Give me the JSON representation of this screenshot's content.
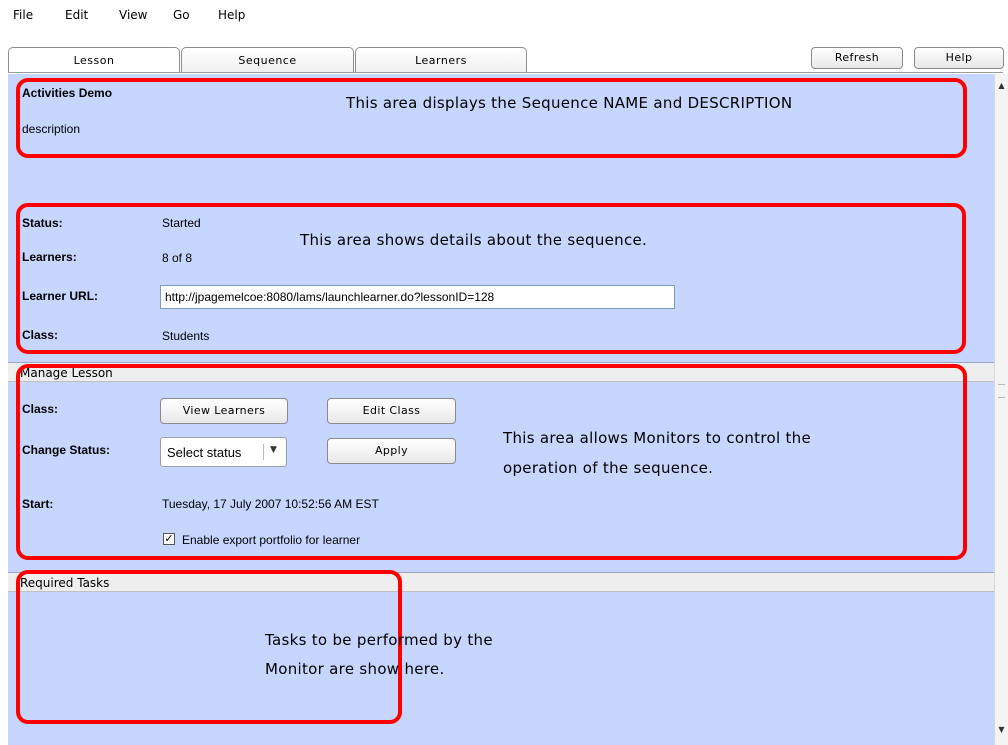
{
  "menu": [
    "File",
    "Edit",
    "View",
    "Go",
    "Help"
  ],
  "tabs": [
    {
      "label": "Lesson",
      "active": true
    },
    {
      "label": "Sequence",
      "active": false
    },
    {
      "label": "Learners",
      "active": false
    }
  ],
  "toolbar": {
    "refresh_label": "Refresh",
    "help_label": "Help"
  },
  "sequence": {
    "name": "Activities Demo",
    "description": "description"
  },
  "details": {
    "status_label": "Status:",
    "status_value": "Started",
    "learners_label": "Learners:",
    "learners_value": "8 of 8",
    "url_label": "Learner URL:",
    "url_value": "http://jpagemelcoe:8080/lams/launchlearner.do?lessonID=128",
    "class_label": "Class:",
    "class_value": "Students"
  },
  "manage": {
    "header": "Manage Lesson",
    "class_label": "Class:",
    "view_learners_label": "View Learners",
    "edit_class_label": "Edit Class",
    "change_status_label": "Change Status:",
    "status_select_value": "Select status",
    "apply_label": "Apply",
    "start_label": "Start:",
    "start_value": "Tuesday, 17 July 2007 10:52:56 AM EST",
    "export_checkbox_label": "Enable export portfolio for learner",
    "export_checked": true
  },
  "required": {
    "header": "Required Tasks"
  },
  "annotations": {
    "name_area": "This area displays the Sequence NAME and DESCRIPTION",
    "details_area": "This area shows details about the sequence.",
    "manage_area_line1": "This area allows Monitors to control the",
    "manage_area_line2": "operation of the sequence.",
    "tasks_area_line1": "Tasks to be performed by the",
    "tasks_area_line2": "Monitor are show here."
  },
  "colors": {
    "panel": "#c7d6ff",
    "annotation": "#ff0000"
  }
}
